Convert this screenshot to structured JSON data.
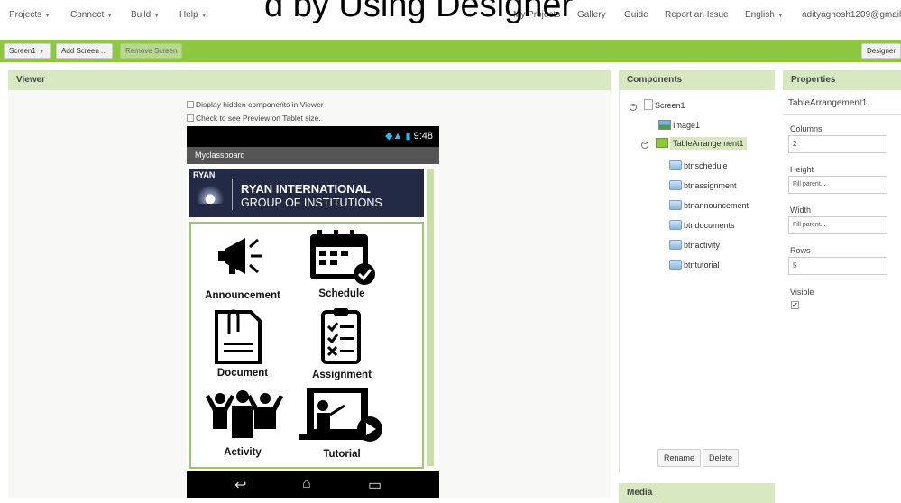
{
  "overlay_title": "d by Using Designer",
  "topnav": {
    "left": [
      "Projects",
      "Connect",
      "Build",
      "Help"
    ],
    "right": [
      "My Projects",
      "Gallery",
      "Guide",
      "Report an Issue",
      "English",
      "adityaghosh1209@gmail"
    ]
  },
  "toolbar": {
    "screen_select": "Screen1",
    "add_screen": "Add Screen ...",
    "remove_screen": "Remove Screen",
    "designer": "Designer"
  },
  "viewer": {
    "title": "Viewer",
    "hidden_components": "Display hidden components in Viewer",
    "tablet_preview": "Check to see Preview on Tablet size.",
    "phone": {
      "time": "9:48",
      "app_title": "Myclassboard",
      "banner": {
        "ryan": "RYAN",
        "line1": "RYAN INTERNATIONAL",
        "line2": "GROUP OF INSTITUTIONS"
      },
      "cells": [
        {
          "label": "Announcement",
          "icon": "megaphone-icon"
        },
        {
          "label": "Schedule",
          "icon": "calendar-icon"
        },
        {
          "label": "Document",
          "icon": "document-icon"
        },
        {
          "label": "Assignment",
          "icon": "checklist-icon"
        },
        {
          "label": "Activity",
          "icon": "people-icon"
        },
        {
          "label": "Tutorial",
          "icon": "teacher-icon"
        }
      ]
    }
  },
  "components": {
    "title": "Components",
    "tree": {
      "screen": "Screen1",
      "image": "Image1",
      "table": "TableArrangement1",
      "buttons": [
        "btnschedule",
        "btnassignment",
        "btnannouncement",
        "btndocuments",
        "btnactivity",
        "btntutorial"
      ]
    },
    "rename": "Rename",
    "delete": "Delete",
    "media": "Media"
  },
  "properties": {
    "title": "Properties",
    "component": "TableArrangement1",
    "columns_label": "Columns",
    "columns_value": "2",
    "height_label": "Height",
    "height_value": "Fill parent...",
    "width_label": "Width",
    "width_value": "Fill parent...",
    "rows_label": "Rows",
    "rows_value": "5",
    "visible_label": "Visible",
    "visible_checked": true
  },
  "colors": {
    "accent_green": "#8dc63f",
    "panel_header": "#d8e8c1",
    "banner_navy": "#232a45"
  }
}
